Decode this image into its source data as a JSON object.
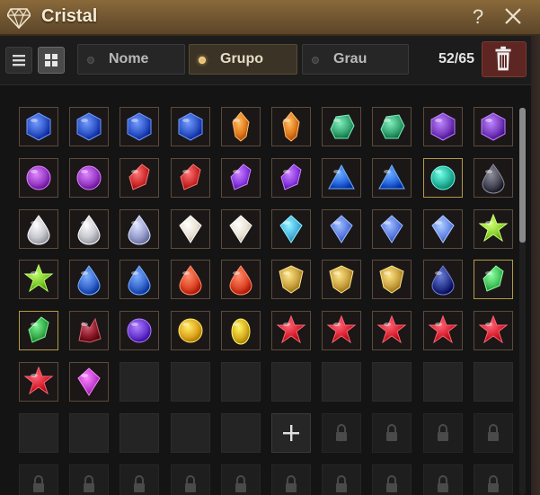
{
  "window": {
    "title": "Cristal",
    "help_label": "?",
    "title_icon": "diamond-icon",
    "close_icon": "close-icon"
  },
  "toolbar": {
    "view_list_icon": "list-view-icon",
    "view_grid_icon": "grid-view-icon",
    "active_view": "grid",
    "sort_tabs": [
      {
        "label": "Nome",
        "active": false
      },
      {
        "label": "Grupo",
        "active": true
      },
      {
        "label": "Grau",
        "active": false
      }
    ],
    "count": "52/65",
    "delete_icon": "trash-icon"
  },
  "inventory": {
    "capacity": 65,
    "used": 52,
    "items": [
      {
        "icon": "gem-blue-hex",
        "color": "#2f56c8",
        "border": "normal"
      },
      {
        "icon": "gem-blue-hex",
        "color": "#2f56c8",
        "border": "normal"
      },
      {
        "icon": "gem-blue-hex",
        "color": "#2f56c8",
        "border": "normal"
      },
      {
        "icon": "gem-blue-hex",
        "color": "#2f56c8",
        "border": "normal"
      },
      {
        "icon": "gem-orange-fire",
        "color": "#e07a1e",
        "border": "normal"
      },
      {
        "icon": "gem-orange-fire",
        "color": "#e07a1e",
        "border": "normal"
      },
      {
        "icon": "gem-green-chunk",
        "color": "#3aa876",
        "border": "normal"
      },
      {
        "icon": "gem-green-chunk",
        "color": "#3aa876",
        "border": "normal"
      },
      {
        "icon": "gem-purple-hex",
        "color": "#7a3fc0",
        "border": "normal"
      },
      {
        "icon": "gem-purple-hex",
        "color": "#7a3fc0",
        "border": "normal"
      },
      {
        "icon": "gem-purple-round",
        "color": "#9a3fc8",
        "border": "normal"
      },
      {
        "icon": "gem-purple-round",
        "color": "#9a3fc8",
        "border": "normal"
      },
      {
        "icon": "gem-red-shard",
        "color": "#d03030",
        "border": "normal"
      },
      {
        "icon": "gem-red-shard",
        "color": "#d03030",
        "border": "normal"
      },
      {
        "icon": "gem-violet-shard",
        "color": "#8a3ee0",
        "border": "normal"
      },
      {
        "icon": "gem-violet-shard",
        "color": "#8a3ee0",
        "border": "normal"
      },
      {
        "icon": "gem-blue-triangle",
        "color": "#2a6ae0",
        "border": "normal"
      },
      {
        "icon": "gem-blue-triangle",
        "color": "#2a6ae0",
        "border": "normal"
      },
      {
        "icon": "gem-teal-round",
        "color": "#2ab8a0",
        "border": "gold"
      },
      {
        "icon": "gem-dark-drop",
        "color": "#4a4a58",
        "border": "normal"
      },
      {
        "icon": "gem-silver-drop",
        "color": "#c8c8d0",
        "border": "normal"
      },
      {
        "icon": "gem-silver-drop",
        "color": "#c8c8d0",
        "border": "normal"
      },
      {
        "icon": "gem-silver-drop",
        "color": "#9aa0d0",
        "border": "normal"
      },
      {
        "icon": "gem-white-diamond",
        "color": "#e8e0d0",
        "border": "normal"
      },
      {
        "icon": "gem-white-diamond",
        "color": "#e8e0d0",
        "border": "normal"
      },
      {
        "icon": "gem-cyan-pendant",
        "color": "#4ab0e0",
        "border": "normal"
      },
      {
        "icon": "gem-cyan-pendant",
        "color": "#5a7ae0",
        "border": "normal"
      },
      {
        "icon": "gem-cyan-pendant",
        "color": "#5a7ae0",
        "border": "normal"
      },
      {
        "icon": "gem-cyan-pendant",
        "color": "#6a8ae8",
        "border": "normal"
      },
      {
        "icon": "gem-green-star",
        "color": "#8ad030",
        "border": "normal"
      },
      {
        "icon": "gem-green-star",
        "color": "#7ac828",
        "border": "normal"
      },
      {
        "icon": "gem-blue-drop",
        "color": "#3a6ad0",
        "border": "normal"
      },
      {
        "icon": "gem-blue-drop",
        "color": "#3a6ad0",
        "border": "normal"
      },
      {
        "icon": "gem-red-drop",
        "color": "#e04a2a",
        "border": "normal"
      },
      {
        "icon": "gem-red-drop",
        "color": "#e04a2a",
        "border": "normal"
      },
      {
        "icon": "gem-gold-shield",
        "color": "#c8a040",
        "border": "normal"
      },
      {
        "icon": "gem-gold-shield",
        "color": "#c8a040",
        "border": "normal"
      },
      {
        "icon": "gem-gold-shield",
        "color": "#c8a040",
        "border": "normal"
      },
      {
        "icon": "gem-navy-drop",
        "color": "#2a3a90",
        "border": "normal"
      },
      {
        "icon": "gem-green-crystal",
        "color": "#4ac860",
        "border": "gold"
      },
      {
        "icon": "gem-green-crystal",
        "color": "#3ab050",
        "border": "gold"
      },
      {
        "icon": "gem-dark-red-cluster",
        "color": "#8a1a2a",
        "border": "normal"
      },
      {
        "icon": "gem-purple-orb",
        "color": "#6a3ad0",
        "border": "normal"
      },
      {
        "icon": "gem-gold-orb",
        "color": "#e0a820",
        "border": "normal"
      },
      {
        "icon": "gem-gold-egg",
        "color": "#d8b020",
        "border": "normal"
      },
      {
        "icon": "gem-red-star",
        "color": "#d82030",
        "border": "normal"
      },
      {
        "icon": "gem-red-star",
        "color": "#d82030",
        "border": "normal"
      },
      {
        "icon": "gem-red-star",
        "color": "#d82030",
        "border": "normal"
      },
      {
        "icon": "gem-red-star",
        "color": "#d82030",
        "border": "normal"
      },
      {
        "icon": "gem-red-star",
        "color": "#d82030",
        "border": "normal"
      },
      {
        "icon": "gem-red-star",
        "color": "#d82030",
        "border": "normal"
      },
      {
        "icon": "gem-pink-diamond",
        "color": "#c040d0",
        "border": "normal"
      }
    ],
    "empty_slots": 13,
    "add_slot_icon": "plus-icon",
    "visible_locked_slots": 14,
    "lock_icon": "lock-icon"
  }
}
